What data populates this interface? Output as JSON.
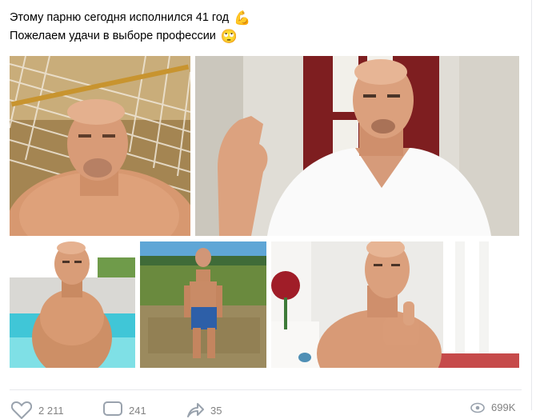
{
  "post": {
    "line1": "Этому парню сегодня исполнился 41 год",
    "line1_emoji": "💪",
    "line2": "Пожелаем удачи в выборе профессии",
    "line2_emoji": "🙄"
  },
  "actions": {
    "likes": "2 211",
    "comments": "241",
    "shares": "35",
    "views": "699K"
  },
  "icons": {
    "like": "heart-icon",
    "comment": "comment-icon",
    "share": "share-icon",
    "views": "eye-icon"
  }
}
